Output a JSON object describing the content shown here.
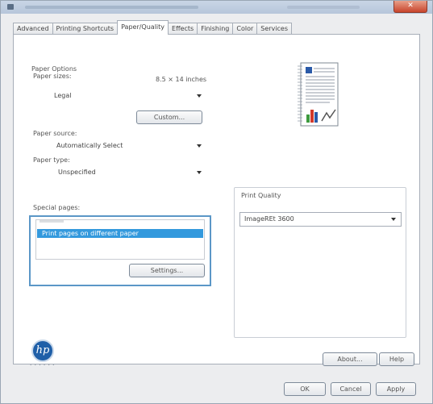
{
  "window": {
    "close_glyph": "✕"
  },
  "tabs": [
    {
      "label": "Advanced"
    },
    {
      "label": "Printing Shortcuts"
    },
    {
      "label": "Paper/Quality"
    },
    {
      "label": "Effects"
    },
    {
      "label": "Finishing"
    },
    {
      "label": "Color"
    },
    {
      "label": "Services"
    }
  ],
  "active_tab": "Paper/Quality",
  "paper_options": {
    "group_label": "Paper Options",
    "size_label": "Paper sizes:",
    "size_dims": "8.5 × 14 inches",
    "size_value": "Legal",
    "custom_button": "Custom...",
    "source_label": "Paper source:",
    "source_value": "Automatically Select",
    "type_label": "Paper type:",
    "type_value": "Unspecified"
  },
  "special_pages": {
    "label": "Special pages:",
    "selected_item": "Print pages on different paper",
    "settings_button": "Settings..."
  },
  "print_quality": {
    "label": "Print Quality",
    "value": "ImageREt 3600"
  },
  "footer": {
    "about_button": "About...",
    "help_button": "Help",
    "ok_button": "OK",
    "cancel_button": "Cancel",
    "apply_button": "Apply"
  },
  "brand": {
    "logo_text": "hp",
    "logo_color": "#1f5fa8"
  },
  "colors": {
    "selection": "#3399dd",
    "highlight_border": "#5b97c7"
  }
}
